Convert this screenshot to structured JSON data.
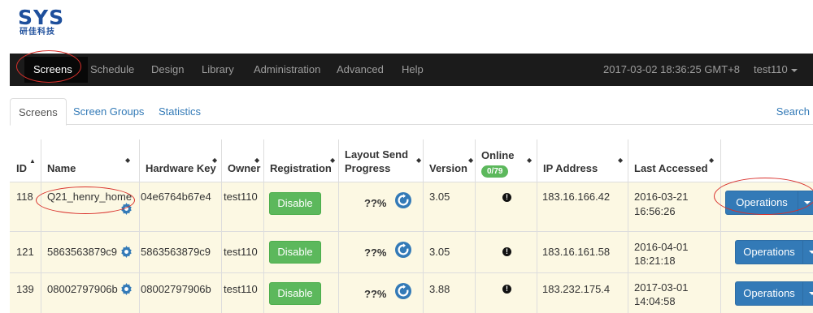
{
  "logo": {
    "mark": "SYS",
    "sub": "研佳科技"
  },
  "nav": {
    "items": [
      "Screens",
      "Schedule",
      "Design",
      "Library",
      "Administration",
      "Advanced",
      "Help"
    ],
    "clock": "2017-03-02 18:36:25 GMT+8",
    "user": "test110"
  },
  "tabs": {
    "items": [
      "Screens",
      "Screen Groups",
      "Statistics"
    ],
    "search": "Search"
  },
  "table": {
    "headers": {
      "id": "ID",
      "name": "Name",
      "hardware_key": "Hardware Key",
      "owner": "Owner",
      "registration": "Registration",
      "layout_line1": "Layout Send",
      "layout_line2": "Progress",
      "version": "Version",
      "online": "Online",
      "online_badge": "0/79",
      "ip": "IP Address",
      "last_accessed": "Last Accessed"
    },
    "rows": [
      {
        "id": "118",
        "name": "Q21_henry_home",
        "hardware_key": "04e6764b67e4",
        "owner": "test110",
        "registration": "Disable",
        "progress": "??%",
        "version": "3.05",
        "online": "!",
        "ip": "183.16.166.42",
        "accessed_date": "2016-03-21",
        "accessed_time": "16:56:26",
        "operations": "Operations"
      },
      {
        "id": "121",
        "name": "5863563879c9",
        "hardware_key": "5863563879c9",
        "owner": "test110",
        "registration": "Disable",
        "progress": "??%",
        "version": "3.05",
        "online": "!",
        "ip": "183.16.161.58",
        "accessed_date": "2016-04-01",
        "accessed_time": "18:21:18",
        "operations": "Operations"
      },
      {
        "id": "139",
        "name": "08002797906b",
        "hardware_key": "08002797906b",
        "owner": "test110",
        "registration": "Disable",
        "progress": "??%",
        "version": "3.88",
        "online": "!",
        "ip": "183.232.175.4",
        "accessed_date": "2017-03-01",
        "accessed_time": "14:04:58",
        "operations": "Operations"
      }
    ]
  },
  "colors": {
    "navbar": "#1b1b1b",
    "link": "#337ab7",
    "green": "#5cb85c",
    "row_highlight": "#fcf8e3",
    "annotation": "#d9302b"
  }
}
